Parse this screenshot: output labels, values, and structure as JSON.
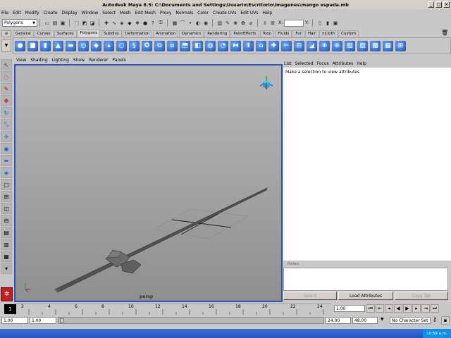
{
  "window": {
    "title": "Autodesk Maya 8.5: C:\\Documents and Settings\\Usuario\\Escritorio\\imagenes\\mango espada.mb"
  },
  "menu": [
    "File",
    "Edit",
    "Modify",
    "Create",
    "Display",
    "Window",
    "Select",
    "Mesh",
    "Edit Mesh",
    "Proxy",
    "Normals",
    "Color",
    "Create UVs",
    "Edit UVs",
    "Help"
  ],
  "status_line": {
    "menu_set": "Polygons",
    "coord_x_label": "X:",
    "coord_y_label": "Y:"
  },
  "shelf_tabs": [
    "General",
    "Curves",
    "Surfaces",
    "Polygons",
    "Subdivs",
    "Deformation",
    "Animation",
    "Dynamics",
    "Rendering",
    "PaintEffects",
    "Toon",
    "Fluids",
    "Fur",
    "Hair",
    "nCloth",
    "Custom"
  ],
  "active_shelf_tab": "Polygons",
  "panel_menu": [
    "View",
    "Shading",
    "Lighting",
    "Show",
    "Renderer",
    "Panels"
  ],
  "viewport": {
    "camera_label": "persp"
  },
  "attribute_editor": {
    "menu": [
      "List",
      "Selected",
      "Focus",
      "Attributes",
      "Help"
    ],
    "message": "Make a selection to view attributes",
    "notes_label": "Notes:",
    "buttons": {
      "select": "Select",
      "load": "Load Attributes",
      "copy": "Copy Tab"
    }
  },
  "timeline": {
    "ticks": [
      "2",
      "4",
      "6",
      "8",
      "10",
      "12",
      "14",
      "16",
      "18",
      "20",
      "22",
      "24"
    ],
    "current_frame": "1",
    "current_time_field": "1.00"
  },
  "range": {
    "start": "1.00",
    "anim_start": "1.00",
    "end": "24.00",
    "anim_end": "48.00",
    "character_set": "No Character Set"
  },
  "taskbar": {
    "clock": "10:59 a.m."
  }
}
